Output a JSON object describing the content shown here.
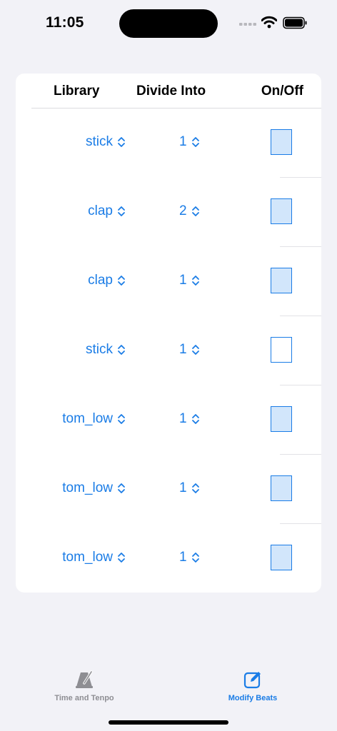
{
  "status_bar": {
    "time": "11:05"
  },
  "table": {
    "headers": {
      "library": "Library",
      "divide_into": "Divide Into",
      "on_off": "On/Off"
    },
    "rows": [
      {
        "library": "stick",
        "divide": "1",
        "on": true
      },
      {
        "library": "clap",
        "divide": "2",
        "on": true
      },
      {
        "library": "clap",
        "divide": "1",
        "on": true
      },
      {
        "library": "stick",
        "divide": "1",
        "on": false
      },
      {
        "library": "tom_low",
        "divide": "1",
        "on": true
      },
      {
        "library": "tom_low",
        "divide": "1",
        "on": true
      },
      {
        "library": "tom_low",
        "divide": "1",
        "on": true
      }
    ]
  },
  "tab_bar": {
    "time_and_tempo": "Time and Tenpo",
    "modify_beats": "Modify Beats",
    "active_tab": "modify_beats"
  },
  "colors": {
    "accent": "#1a7ce6",
    "toggle_fill": "#d2e6fb",
    "inactive_tab": "#8e8e93",
    "background": "#f2f2f7"
  },
  "icons": {
    "time_tab": "metronome-icon",
    "modify_tab": "edit-square-icon",
    "picker": "chevron-updown-icon"
  }
}
